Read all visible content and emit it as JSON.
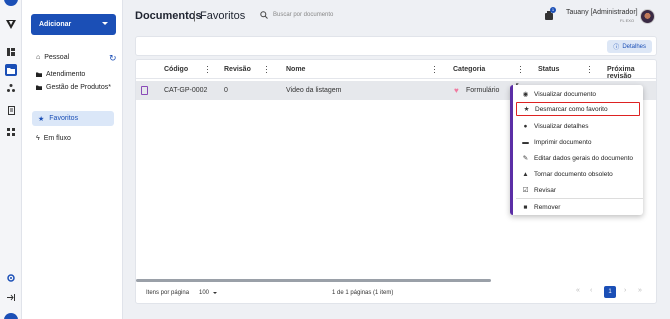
{
  "rail": {
    "icons": [
      "logo-icon",
      "dashboard-icon",
      "folder-icon",
      "hierarchy-icon",
      "report-icon",
      "network-icon",
      "settings-gear-icon",
      "collapse-icon",
      "help-icon"
    ]
  },
  "sidebar": {
    "add_label": "Adicionar",
    "personal_label": "Pessoal",
    "folders": [
      "Atendimento",
      "Gestão de Produtos*"
    ],
    "favorites_label": "Favoritos",
    "flow_label": "Em fluxo"
  },
  "header": {
    "title": "Documentos",
    "separator": "|",
    "subtitle": "Favoritos",
    "search_placeholder": "Buscar por documento",
    "notification_count": "1",
    "user_name": "Tauany [Administrador]",
    "user_code": "FL EXO"
  },
  "toolbar": {
    "details_label": "Detalhes"
  },
  "table": {
    "columns": [
      "Código",
      "Revisão",
      "Nome",
      "Categoria",
      "Status",
      "Próxima revisão"
    ],
    "rows": [
      {
        "code": "CAT-GP-0002",
        "revision": "0",
        "name": "Video da listagem",
        "category": "Formulário",
        "status": "",
        "next_review": ""
      }
    ]
  },
  "pagination": {
    "per_page_label": "Itens por página",
    "per_page_value": "100",
    "info": "1 de 1 páginas (1 item)",
    "current_page": "1",
    "first": "«",
    "prev": "‹",
    "next": "›",
    "last": "»"
  },
  "context_menu": {
    "pointer": "↖",
    "items": [
      {
        "label": "Visualizar documento",
        "icon": "eye-icon",
        "glyph": "◉"
      },
      {
        "label": "Desmarcar como favorito",
        "icon": "star-icon",
        "glyph": "★"
      },
      {
        "label": "Visualizar detalhes",
        "icon": "info-icon",
        "glyph": "●"
      },
      {
        "label": "Imprimir documento",
        "icon": "printer-icon",
        "glyph": "▬"
      },
      {
        "label": "Editar dados gerais do documento",
        "icon": "pencil-icon",
        "glyph": "✎"
      },
      {
        "label": "Tornar documento obsoleto",
        "icon": "warning-icon",
        "glyph": "▲"
      },
      {
        "label": "Revisar",
        "icon": "review-icon",
        "glyph": "☑"
      },
      {
        "label": "Remover",
        "icon": "trash-icon",
        "glyph": "■"
      }
    ]
  },
  "colors": {
    "primary": "#1b4fb6",
    "favorite_bg": "#dbe7f8",
    "highlight_border": "#dd2222",
    "category_heart": "#f07aa0",
    "menu_accent": "#5b2ea6"
  }
}
